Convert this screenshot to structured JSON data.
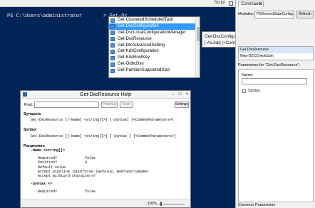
{
  "script_header": {
    "label": "Script"
  },
  "console": {
    "prompt": "PS C:\\Users\\administrator",
    "command": "> Get-Ds"
  },
  "intellisense": {
    "items": [
      "Get-ClusteredScheduledTask",
      "Get-DscConfiguration",
      "Get-DscLocalConfigurationManager",
      "Get-DscResource",
      "Get-DtcAdvancedSetting",
      "Get-KdsConfiguration",
      "Get-KdsRootKey",
      "Get-OdbcDsn",
      "Get-PartitionSupportedSize"
    ],
    "selected_index": 1
  },
  "tooltip": {
    "line1": "Get-DscConfiguration [-CimSession <CimSession[]>] [-Thro",
    "line2": "[-AsJob] [<CommonParameters>]"
  },
  "commands_pane": {
    "tab_label": "Commands",
    "tab_close": "×",
    "modules_label": "Modules:",
    "module_value": "PSDesiredStateConfigu",
    "refresh_label": "Refresh",
    "list": [
      "Get-DscResource",
      "New-DSCCheckSum"
    ],
    "params_for": "Parameters for \"Get-DscResource\":",
    "name_label": "Name:",
    "syntax_label": "Syntax",
    "common_params": "Common Parameters"
  },
  "help": {
    "title": "Get-DscResource Help",
    "find_label": "Find:",
    "previous": "Previous",
    "next": "Next",
    "settings": "Settings",
    "synopsis_head": "Synopsis",
    "synopsis_text": "Get-DscResource [[-Name] <string[]>] [-Syntax] [<CommonParameters>]",
    "syntax_head": "Syntax",
    "syntax_text": "Get-DscResource [[-Name] <string[]>] [-Syntax ] [<CommonParameters>]",
    "params_head": "Parameters",
    "param1": "-Name <string[]>",
    "rows": [
      {
        "k": "Required?",
        "v": "false"
      },
      {
        "k": "Position?",
        "v": "0"
      },
      {
        "k": "Default value",
        "v": ""
      },
      {
        "k": "Accept pipeline input?",
        "v": "true (ByValue, ByPropertyName)"
      },
      {
        "k": "Accept wildcard characters?",
        "v": ""
      }
    ],
    "param2": "-Syntax <>",
    "row2": {
      "k": "Required?",
      "v": "false"
    },
    "zoom": "100%"
  }
}
